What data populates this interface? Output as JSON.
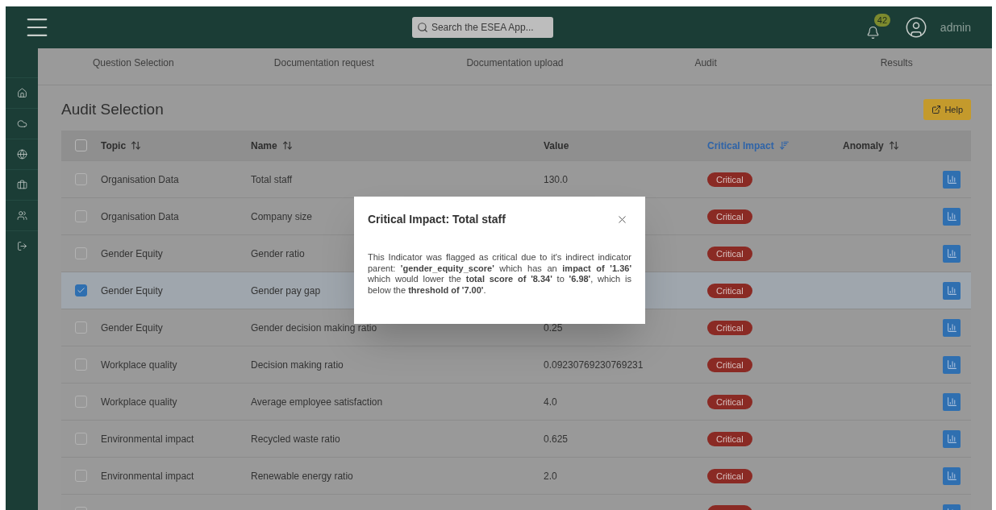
{
  "header": {
    "search": {
      "placeholder": "Search the ESEA App..."
    },
    "notifications": "42",
    "user": "admin"
  },
  "steps": [
    "Question Selection",
    "Documentation request",
    "Documentation upload",
    "Audit",
    "Results"
  ],
  "title": "Audit Selection",
  "help_button": "Help",
  "table": {
    "all_checked": false,
    "columns": [
      {
        "label": "Topic",
        "sorted": false
      },
      {
        "label": "Name",
        "sorted": false
      },
      {
        "label": "Value"
      },
      {
        "label": "Critical Impact",
        "sorted": true
      },
      {
        "label": "Anomaly",
        "sorted": false
      }
    ],
    "rows": [
      {
        "topic": "Organisation Data",
        "name": "Total staff",
        "value": "130.0",
        "impact": "Critical",
        "selected": false
      },
      {
        "topic": "Organisation Data",
        "name": "Company size",
        "impact": "Critical",
        "selected": false
      },
      {
        "topic": "Gender Equity",
        "name": "Gender ratio",
        "impact": "Critical",
        "selected": false
      },
      {
        "topic": "Gender Equity",
        "name": "Gender pay gap",
        "impact": "Critical",
        "selected": true
      },
      {
        "topic": "Gender Equity",
        "name": "Gender decision making ratio",
        "value": "0.25",
        "impact": "Critical",
        "selected": false
      },
      {
        "topic": "Workplace quality",
        "name": "Decision making ratio",
        "value": "0.09230769230769231",
        "impact": "Critical",
        "selected": false
      },
      {
        "topic": "Workplace quality",
        "name": "Average employee satisfaction",
        "value": "4.0",
        "impact": "Critical",
        "selected": false
      },
      {
        "topic": "Environmental impact",
        "name": "Recycled waste ratio",
        "value": "0.625",
        "impact": "Critical",
        "selected": false
      },
      {
        "topic": "Environmental impact",
        "name": "Renewable energy ratio",
        "value": "2.0",
        "impact": "Critical",
        "selected": false
      },
      {
        "selected": false
      }
    ]
  },
  "dialog": {
    "title": "Critical Impact: Total staff",
    "body": "This Indicator was flagged as critical due to it's indirect indicator parent: **'gender_equity_score'** which has an **impact of '1.36'** which would lower the **total score of '8.34'** to **'6.98'**, which is below the **threshold of '7.00'**."
  }
}
